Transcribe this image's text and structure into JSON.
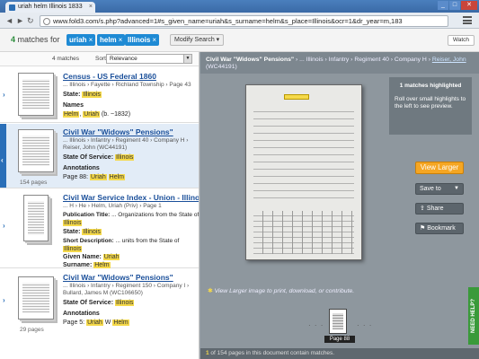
{
  "browser": {
    "tab_title": "uriah helm Illinois 1833",
    "tab_close": "×",
    "url": "www.fold3.com/s.php?advanced=1#s_given_name=uriah&s_surname=helm&s_place=Illinois&ocr=1&dr_year=m,183",
    "back": "◄",
    "forward": "►",
    "reload": "↻"
  },
  "filter": {
    "count": "4",
    "label": "matches for",
    "chips": [
      "uriah",
      "helm",
      "Illinois"
    ],
    "chip_close": "×",
    "modify_label": "Modify Search ▾",
    "watch_label": "Watch"
  },
  "list": {
    "count_text": "4 matches",
    "sort_label": "Sort",
    "sort_value": "Relevance"
  },
  "results": [
    {
      "title": "Census - US Federal 1860",
      "path": "... Illinois › Fayette › Richland Township › Page 43",
      "fields": [
        {
          "label": "State:",
          "value": "Illinois"
        },
        {
          "label": "Names",
          "value": ""
        }
      ],
      "snippet_parts": [
        "Helm",
        "Uriah",
        "(b. ~1832)"
      ],
      "pages": ""
    },
    {
      "title": "Civil War \"Widows\" Pensions\"",
      "path": "... Illinois › Infantry › Regiment 40 › Company H ›",
      "subtitle": "Reiser, John (WC44191)",
      "fields": [
        {
          "label": "State Of Service:",
          "value": "Illinois"
        },
        {
          "label": "Annotations",
          "value": ""
        }
      ],
      "snippet_parts": [
        "Page 88:",
        "Uriah",
        "Helm"
      ],
      "pages": "154 pages"
    },
    {
      "title": "Civil War Service Index - Union - Illinois",
      "path": "... H › He › Helm, Uriah (Priv) › Page 1",
      "fields": [
        {
          "label": "Publication Title:",
          "value": "... Organizations from the State of"
        },
        {
          "label": "",
          "value": "Illinois"
        },
        {
          "label": "State:",
          "value": "Illinois"
        },
        {
          "label": "Short Description:",
          "value": "... units from the State of"
        },
        {
          "label": "",
          "value": "Illinois"
        },
        {
          "label": "Given Name:",
          "value": "Uriah"
        },
        {
          "label": "Surname:",
          "value": "Helm"
        }
      ],
      "pages": ""
    },
    {
      "title": "Civil War \"Widows\" Pensions\"",
      "path": "... Illinois › Infantry › Regiment 150 › Company I ›",
      "subtitle": "Bullard, James M (WC106650)",
      "fields": [
        {
          "label": "State Of Service:",
          "value": "Illinois"
        },
        {
          "label": "Annotations",
          "value": ""
        }
      ],
      "snippet_parts": [
        "Page 5:",
        "Uriah",
        "W",
        "Helm"
      ],
      "pages": "29 pages"
    }
  ],
  "viewer": {
    "header_title": "Civil War \"Widows\" Pensions\"",
    "header_path": " › ... Illinois › Infantry › Regiment 40 › Company H › ",
    "header_link": "Reiser, John",
    "header_id": "(WC44191)",
    "tip_title": "1 matches highlighted",
    "tip_body": "Roll over small highlights to the left to see preview.",
    "view_larger": "View Larger",
    "save_to": "Save to",
    "share": "Share",
    "bookmark": "Bookmark",
    "caption": "View Larger image to print, download, or contribute.",
    "page_label": "Page 88",
    "footer_count": "1",
    "footer_text": " of 154 pages in this document contain matches.",
    "need_help": "NEED HELP?"
  }
}
